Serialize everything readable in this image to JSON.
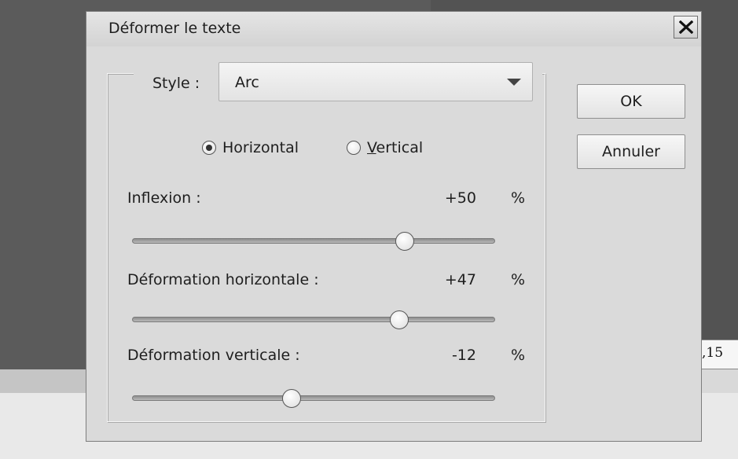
{
  "background": {
    "field_text": ",15"
  },
  "dialog": {
    "title": "Déformer le texte",
    "close_icon": "close-icon",
    "style": {
      "label": "Style :",
      "value": "Arc"
    },
    "orientation": {
      "horizontal_label": "Horizontal",
      "vertical_label_underlined": "V",
      "vertical_label_rest": "ertical",
      "selected": "horizontal"
    },
    "sliders": [
      {
        "label": "Inflexion :",
        "value_text": "+50",
        "unit": "%",
        "value": 50
      },
      {
        "label": "Déformation horizontale :",
        "value_text": "+47",
        "unit": "%",
        "value": 47
      },
      {
        "label": "Déformation verticale :",
        "value_text": "-12",
        "unit": "%",
        "value": -12
      }
    ],
    "buttons": {
      "ok": "OK",
      "cancel": "Annuler"
    }
  }
}
